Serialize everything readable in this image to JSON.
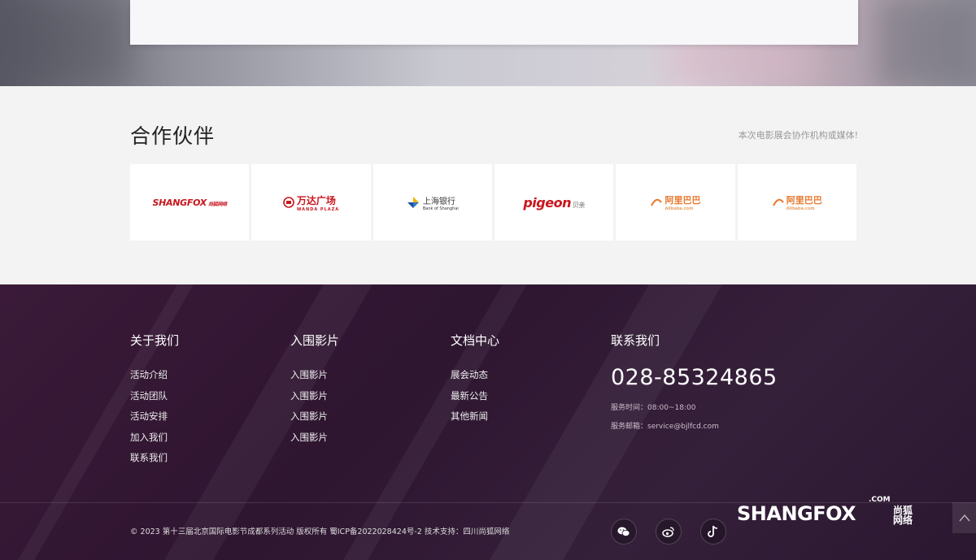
{
  "partners": {
    "title": "合作伙伴",
    "subtitle": "本次电影展会协作机构或媒体!",
    "logos": [
      {
        "name": "shangfox",
        "text": "SHANGFOX",
        "cn": "尚狐网络"
      },
      {
        "name": "wanda",
        "text": "万达广场",
        "sub": "WANDA PLAZA"
      },
      {
        "name": "bank-of-shanghai",
        "text": "上海银行",
        "sub": "Bank of Shanghai"
      },
      {
        "name": "pigeon",
        "text": "pigeon",
        "cn": "贝亲"
      },
      {
        "name": "alibaba-1",
        "text": "阿里巴巴",
        "sub": "Alibaba.com"
      },
      {
        "name": "alibaba-2",
        "text": "阿里巴巴",
        "sub": "Alibaba.com"
      }
    ]
  },
  "footer": {
    "about": {
      "title": "关于我们",
      "links": [
        "活动介绍",
        "活动团队",
        "活动安排",
        "加入我们",
        "联系我们"
      ]
    },
    "films": {
      "title": "入围影片",
      "links": [
        "入围影片",
        "入围影片",
        "入围影片",
        "入围影片"
      ]
    },
    "docs": {
      "title": "文档中心",
      "links": [
        "展会动态",
        "最新公告",
        "其他新闻"
      ]
    },
    "contact": {
      "title": "联系我们",
      "phone": "028-85324865",
      "hours": "服务时间：08:00~18:00",
      "email": "服务邮箱：service@bjlfcd.com"
    },
    "copyright": "© 2023 第十三届北京国际电影节成都系列活动 版权所有 蜀ICP备2022028424号-2   技术支持：四川尚狐网络",
    "social_icons": [
      "wechat-icon",
      "weibo-icon",
      "tiktok-icon"
    ],
    "brand": {
      "name": "SHANGFOX",
      "com": ".COM",
      "cn": "尚狐网络"
    }
  },
  "colors": {
    "footer_bg": "#2e1530",
    "accent_red": "#c8161d",
    "alibaba_orange": "#e8792e"
  }
}
